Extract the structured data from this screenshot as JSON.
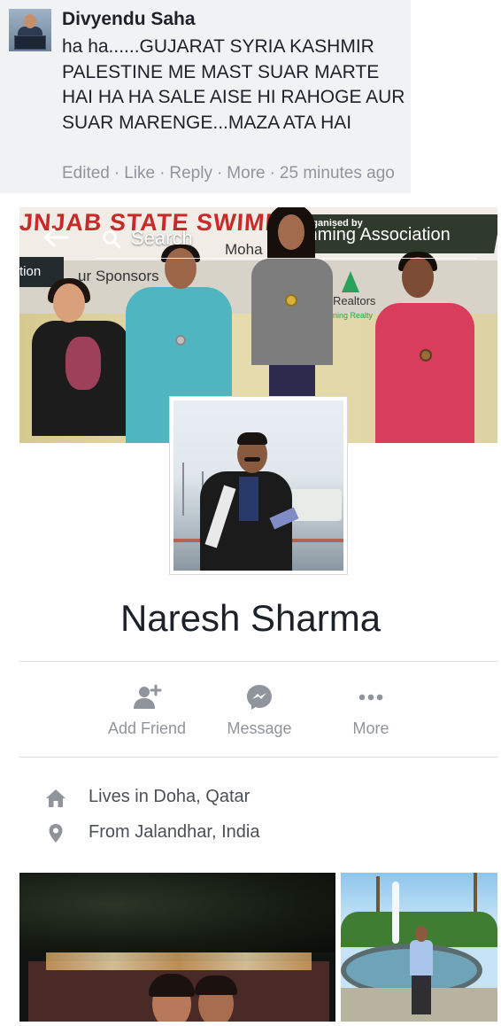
{
  "comment": {
    "author": "Divyendu Saha",
    "text": "ha ha......GUJARAT SYRIA KASHMIR PALESTINE ME MAST SUAR MARTE HAI HA HA SALE AISE HI RAHOGE AUR SUAR MARENGE...MAZA ATA HAI",
    "actions": {
      "edited": "Edited",
      "like": "Like",
      "reply": "Reply",
      "more": "More",
      "time": "25 minutes ago"
    }
  },
  "search": {
    "placeholder": "Search"
  },
  "cover": {
    "banner_title": "JNJAB STATE SWIMMIN",
    "organised_by": "rganised by",
    "association": "mming Association",
    "mohali": "Moha",
    "sponsor_left": "tion",
    "sponsors": "ur Sponsors",
    "realtors": "Realtors",
    "realtors_sub": "ning Realty"
  },
  "profile": {
    "name": "Naresh Sharma",
    "actions": [
      {
        "label": "Add Friend",
        "icon": "add-friend-icon"
      },
      {
        "label": "Message",
        "icon": "messenger-icon"
      },
      {
        "label": "More",
        "icon": "more-dots-icon"
      }
    ],
    "info": [
      {
        "icon": "home-icon",
        "text": "Lives in Doha, Qatar"
      },
      {
        "icon": "location-pin-icon",
        "text": "From Jalandhar, India"
      }
    ]
  },
  "colors": {
    "icon_gray": "#90949c",
    "text_gray": "#4b4f56",
    "comment_bg": "#f1f2f4"
  }
}
